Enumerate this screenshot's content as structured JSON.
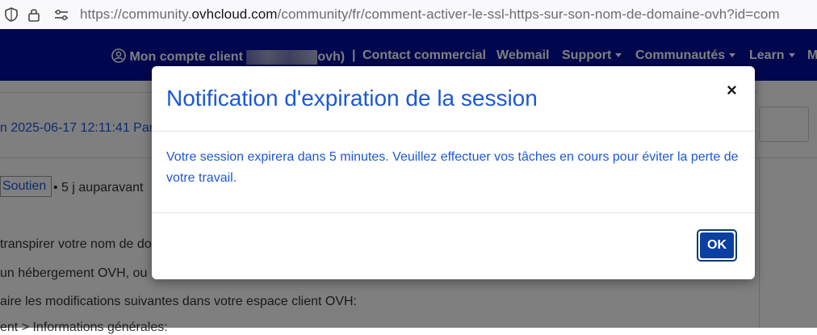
{
  "browser": {
    "url_prefix": "https://community.",
    "url_host": "ovhcloud.com",
    "url_suffix": "/community/fr/comment-activer-le-ssl-https-sur-son-nom-de-domaine-ovh?id=com"
  },
  "nav": {
    "account_prefix": "Mon compte client",
    "account_suffix": "ovh)",
    "separator": "|",
    "contact": "Contact commercial",
    "webmail": "Webmail",
    "support": "Support",
    "communities": "Communautés",
    "learn": "Learn",
    "more": "M"
  },
  "page": {
    "meta": "n 2025-06-17 12:11:41 Par",
    "tag": "Soutien",
    "ago": "• 5 j auparavant",
    "lines": [
      "transpirer votre nom de do",
      "un hébergement OVH, ou",
      "aire les modifications suivantes dans votre espace client OVH:",
      "ent > Informations générales:"
    ]
  },
  "modal": {
    "title": "Notification d'expiration de la session",
    "close": "×",
    "message": "Votre session expirera dans 5 minutes. Veuillez effectuer vos tâches en cours pour éviter la perte de votre travail.",
    "ok": "OK"
  }
}
